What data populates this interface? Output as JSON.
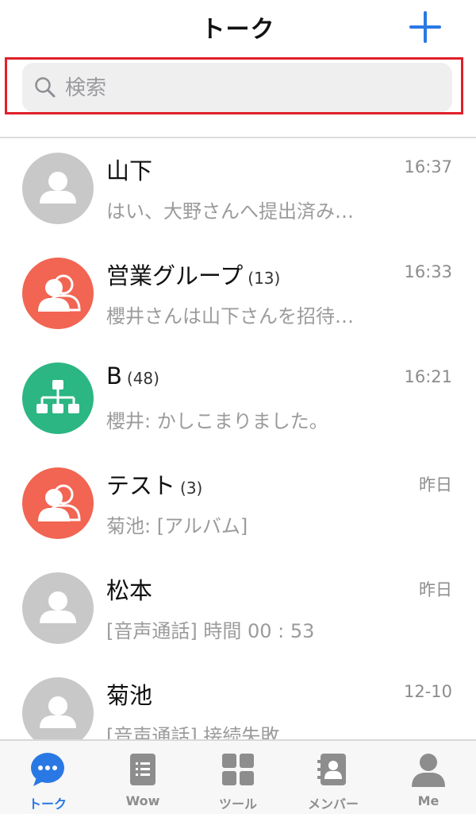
{
  "header": {
    "title": "トーク",
    "add_icon": "plus-icon"
  },
  "colors": {
    "accent": "#2a78e4",
    "highlight": "#e0202a",
    "avatar_gray": "#c8c8c8",
    "avatar_red": "#f16552",
    "avatar_green": "#2bb683",
    "muted_text": "#9b9b9b"
  },
  "search": {
    "placeholder": "検索",
    "value": "",
    "icon": "search-icon"
  },
  "chats": [
    {
      "name": "山下",
      "count": "",
      "time": "16:37",
      "preview": "はい、大野さんへ提出済み…",
      "avatar": "person-icon"
    },
    {
      "name": "営業グループ",
      "count": "(13)",
      "time": "16:33",
      "preview": "櫻井さんは山下さんを招待…",
      "avatar": "group-icon"
    },
    {
      "name": "B",
      "count": "(48)",
      "time": "16:21",
      "preview": "櫻井: かしこまりました。",
      "avatar": "org-chart-icon"
    },
    {
      "name": "テスト",
      "count": "(3)",
      "time": "昨日",
      "preview": "菊池: [アルバム]",
      "avatar": "group-icon"
    },
    {
      "name": "松本",
      "count": "",
      "time": "昨日",
      "preview": "[音声通話] 時間 00 : 53",
      "avatar": "person-icon"
    },
    {
      "name": "菊池",
      "count": "",
      "time": "12-10",
      "preview": "[音声通話] 接続失敗",
      "avatar": "person-icon"
    }
  ],
  "tabs": [
    {
      "label": "トーク",
      "icon": "chat-bubble-icon",
      "active": true
    },
    {
      "label": "Wow",
      "icon": "note-icon",
      "active": false
    },
    {
      "label": "ツール",
      "icon": "grid-icon",
      "active": false
    },
    {
      "label": "メンバー",
      "icon": "contacts-icon",
      "active": false
    },
    {
      "label": "Me",
      "icon": "profile-icon",
      "active": false
    }
  ]
}
